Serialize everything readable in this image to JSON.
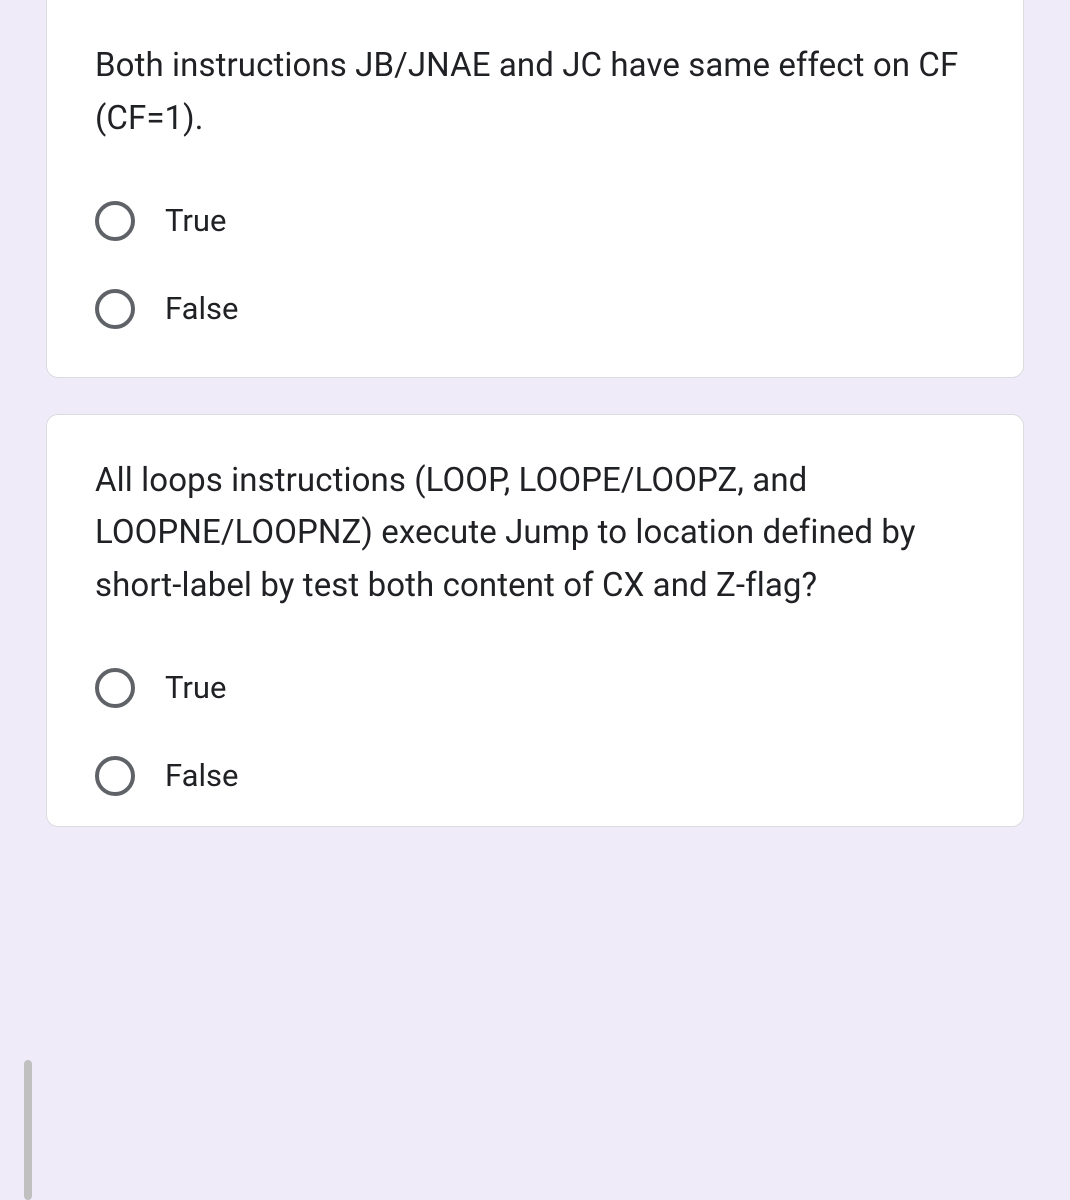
{
  "questions": [
    {
      "text": "Both instructions JB/JNAE and JC have same effect on CF (CF=1).",
      "options": [
        "True",
        "False"
      ]
    },
    {
      "text": "All loops instructions (LOOP, LOOPE/LOOPZ, and LOOPNE/LOOPNZ) execute Jump to location defined by short-label by test both content of CX and Z-flag?",
      "options": [
        "True",
        "False"
      ]
    }
  ]
}
